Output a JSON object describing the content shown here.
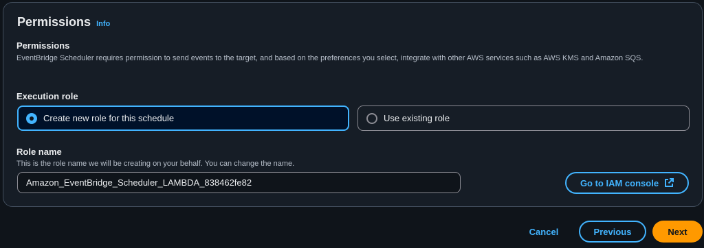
{
  "panel": {
    "title": "Permissions",
    "info_label": "Info",
    "section_label": "Permissions",
    "section_description": "EventBridge Scheduler requires permission to send events to the target, and based on the preferences you select, integrate with other AWS services such as AWS KMS and Amazon SQS."
  },
  "execution_role": {
    "label": "Execution role",
    "options": [
      {
        "label": "Create new role for this schedule",
        "selected": true
      },
      {
        "label": "Use existing role",
        "selected": false
      }
    ]
  },
  "role_name": {
    "label": "Role name",
    "description": "This is the role name we will be creating on your behalf. You can change the name.",
    "value": "Amazon_EventBridge_Scheduler_LAMBDA_838462fe82"
  },
  "iam_button": {
    "label": "Go to IAM console",
    "icon": "external-link-icon"
  },
  "footer": {
    "cancel_label": "Cancel",
    "previous_label": "Previous",
    "next_label": "Next"
  },
  "colors": {
    "accent": "#42b4ff",
    "primary_button": "#ff9900",
    "background": "#0f141a",
    "panel": "#161d26"
  }
}
